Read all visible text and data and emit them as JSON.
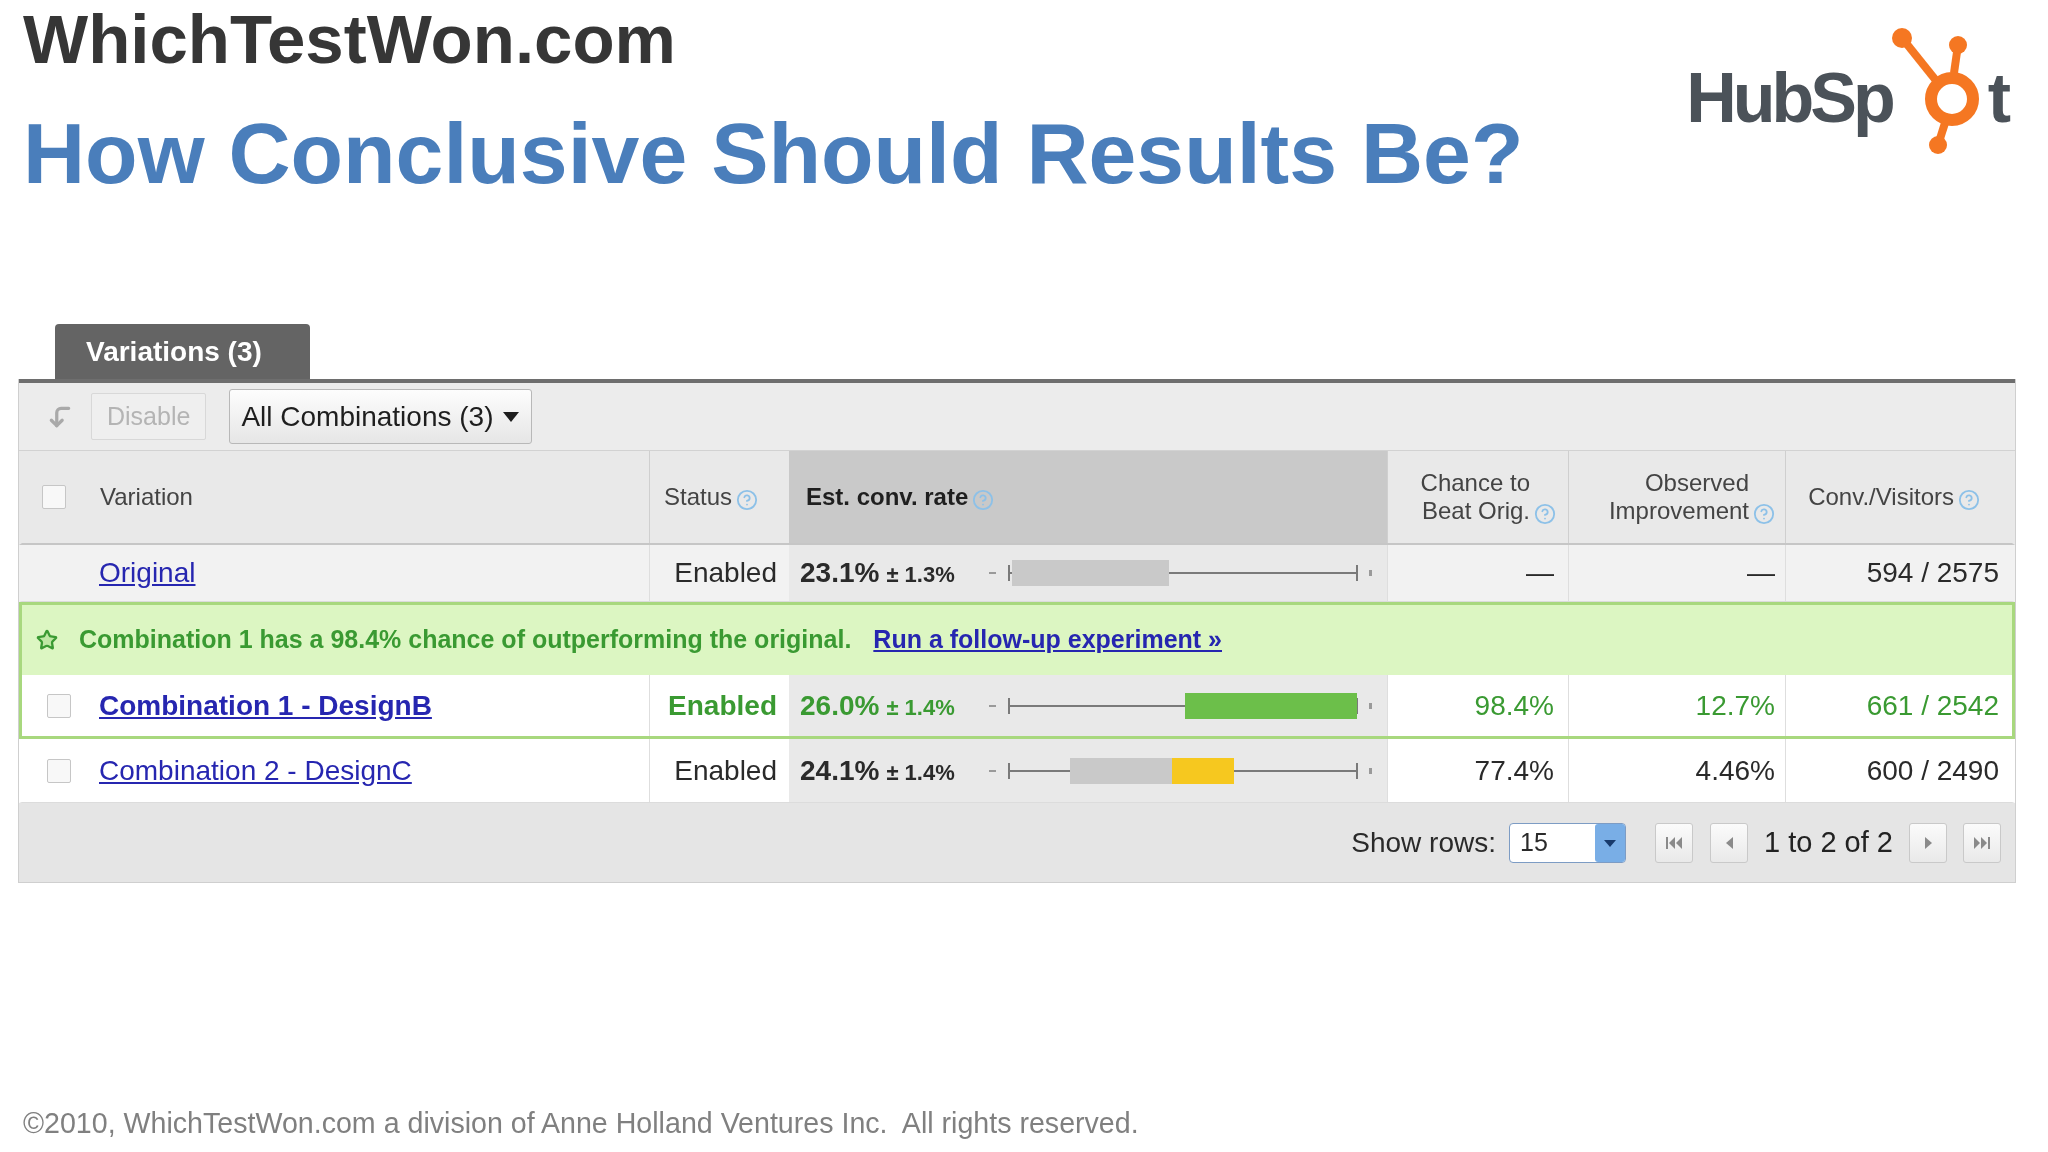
{
  "header": {
    "site_name": "WhichTestWon.com",
    "title": "How Conclusive Should Results Be?"
  },
  "logo": {
    "text_start": "HubSp",
    "text_end": "t"
  },
  "tabs": [
    {
      "label": "Variations (3)",
      "selected": true
    }
  ],
  "toolbar": {
    "disable_button": {
      "label": "Disable",
      "disabled": true
    },
    "filter_dropdown": {
      "value": "All Combinations (3)"
    }
  },
  "table": {
    "select_all": {
      "checked": false
    },
    "columns": [
      {
        "label": "Variation",
        "sorted": false,
        "help_icon": false
      },
      {
        "label": "Status",
        "sorted": false,
        "help_icon": true
      },
      {
        "label": "Est. conv. rate",
        "sorted": true,
        "help_icon": true
      },
      {
        "label": "Chance to Beat Orig.",
        "sorted": false,
        "help_icon": true
      },
      {
        "label": "Observed Improvement",
        "sorted": false,
        "help_icon": true
      },
      {
        "label": "Conv./Visitors",
        "sorted": false,
        "help_icon": true
      }
    ],
    "rows": [
      {
        "kind": "original",
        "name": "Original",
        "highlighted": false,
        "status": "Enabled",
        "rate": "23.1%",
        "margin": "± 1.3%",
        "interval": {
          "kind": "baseline"
        },
        "chance": "—",
        "improvement": "—",
        "conversions": "594 / 2575"
      },
      {
        "kind": "notice",
        "text": "Combination 1 has a 98.4% chance of outperforming the original.",
        "link": "Run a follow-up experiment »"
      },
      {
        "kind": "variation",
        "name": "Combination 1 - DesignB",
        "checked": false,
        "highlighted": true,
        "status": "Enabled",
        "rate": "26.0%",
        "margin": "± 1.4%",
        "interval": {
          "kind": "winner"
        },
        "chance": "98.4%",
        "improvement": "12.7%",
        "conversions": "661 / 2542"
      },
      {
        "kind": "variation",
        "name": "Combination 2 - DesignC",
        "checked": false,
        "highlighted": false,
        "status": "Enabled",
        "rate": "24.1%",
        "margin": "± 1.4%",
        "interval": {
          "kind": "mixed"
        },
        "chance": "77.4%",
        "improvement": "4.46%",
        "conversions": "600 / 2490"
      }
    ]
  },
  "pager": {
    "rows_label": "Show rows:",
    "rows_value": "15",
    "range": "1 to 2 of 2"
  },
  "footer": {
    "copyright": "©2010, WhichTestWon.com a division of Anne Holland Ventures Inc.  All rights reserved."
  }
}
